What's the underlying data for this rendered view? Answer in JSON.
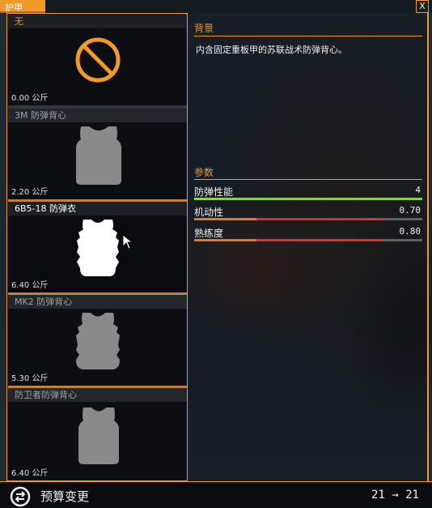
{
  "window": {
    "title": "护甲",
    "close_label": "X"
  },
  "items": [
    {
      "name": "无",
      "weight": "0.00 公斤",
      "icon": "none-icon"
    },
    {
      "name": "3M 防弹背心",
      "weight": "2.20 公斤",
      "icon": "vest-icon"
    },
    {
      "name": "6B5-18 防弹衣",
      "weight": "6.40 公斤",
      "icon": "heavy-vest-icon",
      "selected": true
    },
    {
      "name": "MK2 防弹背心",
      "weight": "5.30 公斤",
      "icon": "vest-icon"
    },
    {
      "name": "防卫者防弹背心",
      "weight": "6.40 公斤",
      "icon": "vest-icon"
    }
  ],
  "background": {
    "title": "背景",
    "description": "内含固定重板甲的苏联战术防弹背心。"
  },
  "params": {
    "title": "参数",
    "stats": [
      {
        "label": "防弹性能",
        "value": "4",
        "fill": 1.0,
        "color": "#8fd040"
      },
      {
        "label": "机动性",
        "value": "0.70",
        "fill": 0.83,
        "color": "#d8342c"
      },
      {
        "label": "熟练度",
        "value": "0.80",
        "fill": 0.83,
        "color": "#d8342c"
      }
    ]
  },
  "budget": {
    "label": "预算变更",
    "value": "21 → 21"
  },
  "colors": {
    "accent": "#f09a2a",
    "good": "#8fd040",
    "bad": "#d8342c"
  }
}
